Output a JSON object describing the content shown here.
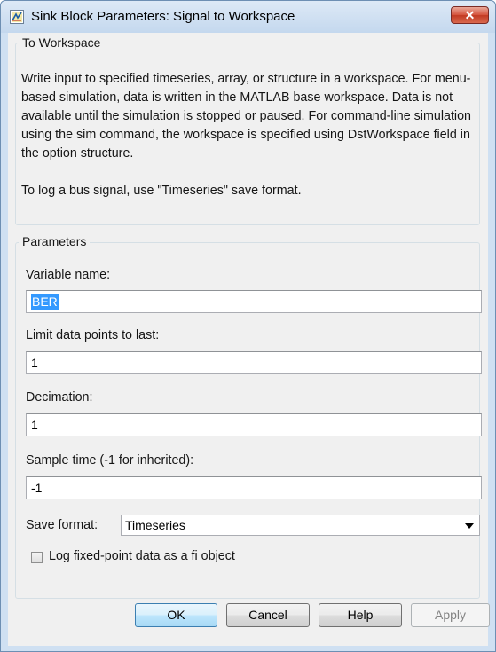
{
  "window": {
    "title": "Sink Block Parameters: Signal to Workspace",
    "close_glyph": "✕",
    "app_icon": "simulink-block-icon"
  },
  "description_group": {
    "title": "To Workspace",
    "paragraph1": "Write input to specified timeseries, array, or structure in a workspace. For menu-based simulation, data is written in the MATLAB base workspace. Data is not available until the simulation is stopped or paused. For command-line simulation using the sim command, the workspace is specified using DstWorkspace field in the option structure.",
    "paragraph2": "To log a bus signal, use \"Timeseries\" save format."
  },
  "parameters": {
    "title": "Parameters",
    "variable_name": {
      "label": "Variable name:",
      "value": "BER"
    },
    "limit_data_points": {
      "label": "Limit data points to last:",
      "value": "1"
    },
    "decimation": {
      "label": "Decimation:",
      "value": "1"
    },
    "sample_time": {
      "label": "Sample time (-1 for inherited):",
      "value": "-1"
    },
    "save_format": {
      "label": "Save format:",
      "value": "Timeseries"
    },
    "log_fixed_point": {
      "label": "Log fixed-point data as a fi object",
      "checked": false
    }
  },
  "buttons": {
    "ok": "OK",
    "cancel": "Cancel",
    "help": "Help",
    "apply": "Apply"
  },
  "colors": {
    "client_background": "#f0f0f0",
    "selection_highlight": "#3399ff",
    "close_button": "#c74a32",
    "default_button": "#bee6fd"
  }
}
